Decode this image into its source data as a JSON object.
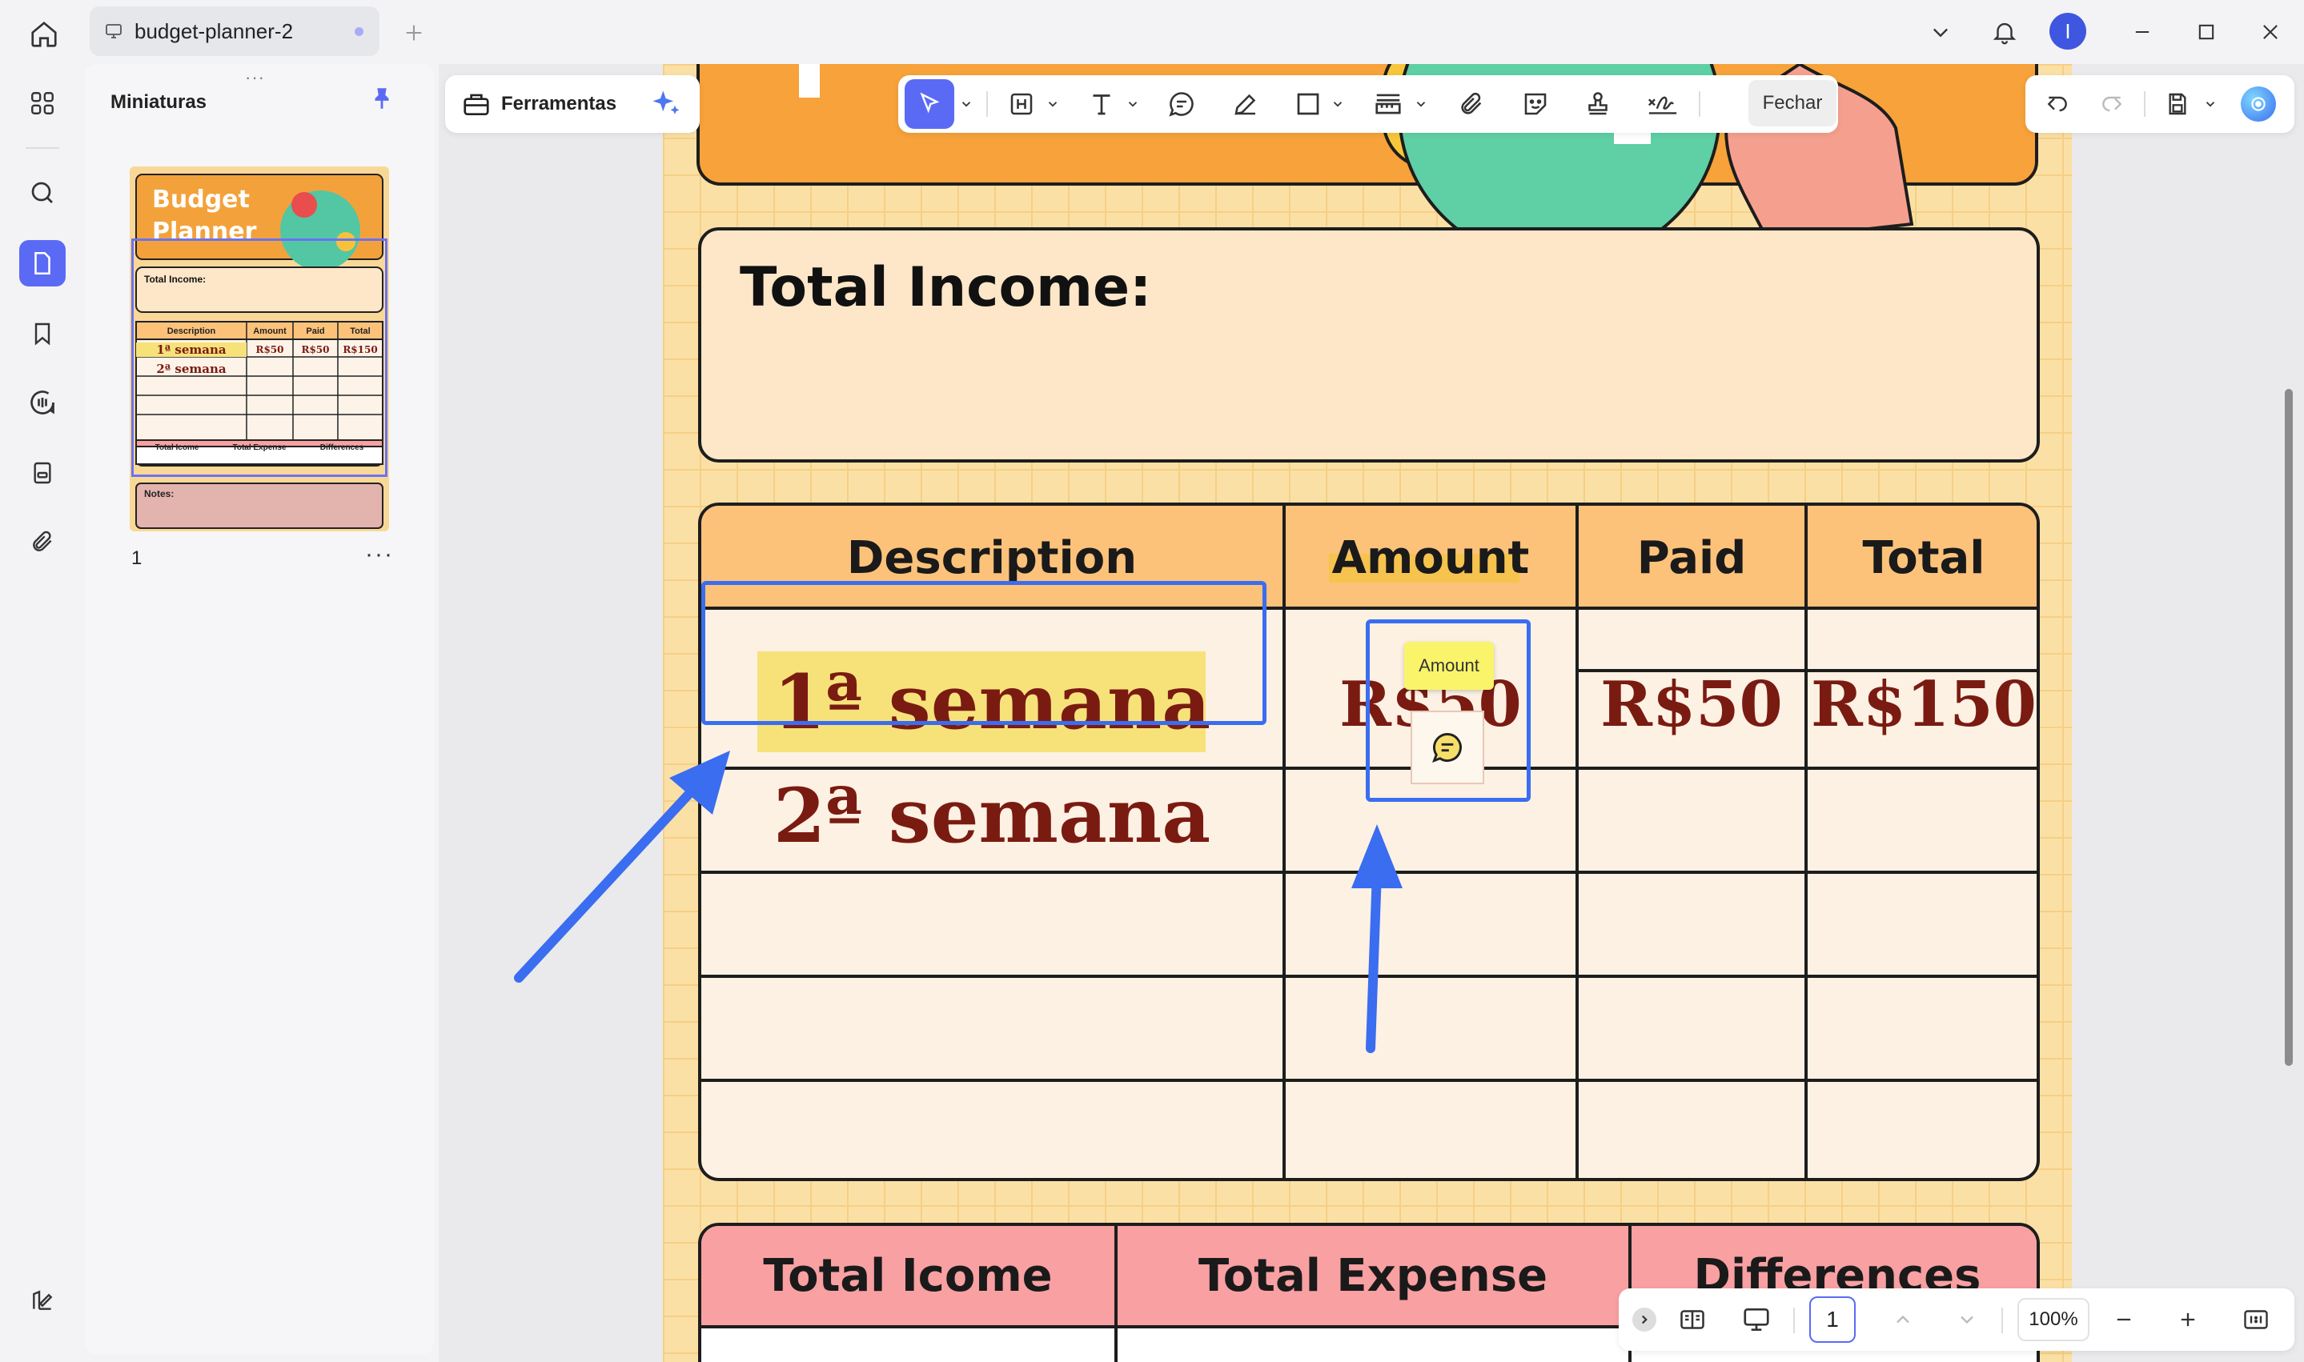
{
  "window": {
    "tab_title": "budget-planner-2",
    "user_initial": "I"
  },
  "sidebar_panel": {
    "title": "Miniaturas",
    "page_number": "1",
    "more": "···",
    "thumb": {
      "title": "Budget Planner",
      "total_income": "Total Income:",
      "headers": [
        "Description",
        "Amount",
        "Paid",
        "Total"
      ],
      "row1": [
        "1ª semana",
        "R$50",
        "R$50",
        "R$150"
      ],
      "row2": [
        "2ª semana"
      ],
      "footer": [
        "Total Icome",
        "Total Expense",
        "Differences"
      ],
      "notes": "Notes:"
    }
  },
  "toolbar": {
    "tools_label": "Ferramentas",
    "close_label": "Fechar"
  },
  "document": {
    "total_income_label": "Total Income:",
    "table_headers": {
      "description": "Description",
      "amount": "Amount",
      "paid": "Paid",
      "total": "Total"
    },
    "rows": [
      {
        "description": "1ª semana",
        "amount": "R$50",
        "paid": "R$50",
        "total": "R$150"
      },
      {
        "description": "2ª semana",
        "amount": "",
        "paid": "",
        "total": ""
      }
    ],
    "comment_tooltip": "Amount",
    "footer_headers": {
      "income": "Total Icome",
      "expense": "Total Expense",
      "differences": "Differences"
    }
  },
  "bottom_bar": {
    "page_input": "1",
    "zoom": "100%"
  },
  "colors": {
    "accent": "#5b6af5",
    "annotation_blue": "#3a6df0",
    "page_bg": "#fbe0a6",
    "header_orange": "#fcc27a",
    "footer_pink": "#f8a0a2",
    "value_maroon": "#7a1b12"
  }
}
